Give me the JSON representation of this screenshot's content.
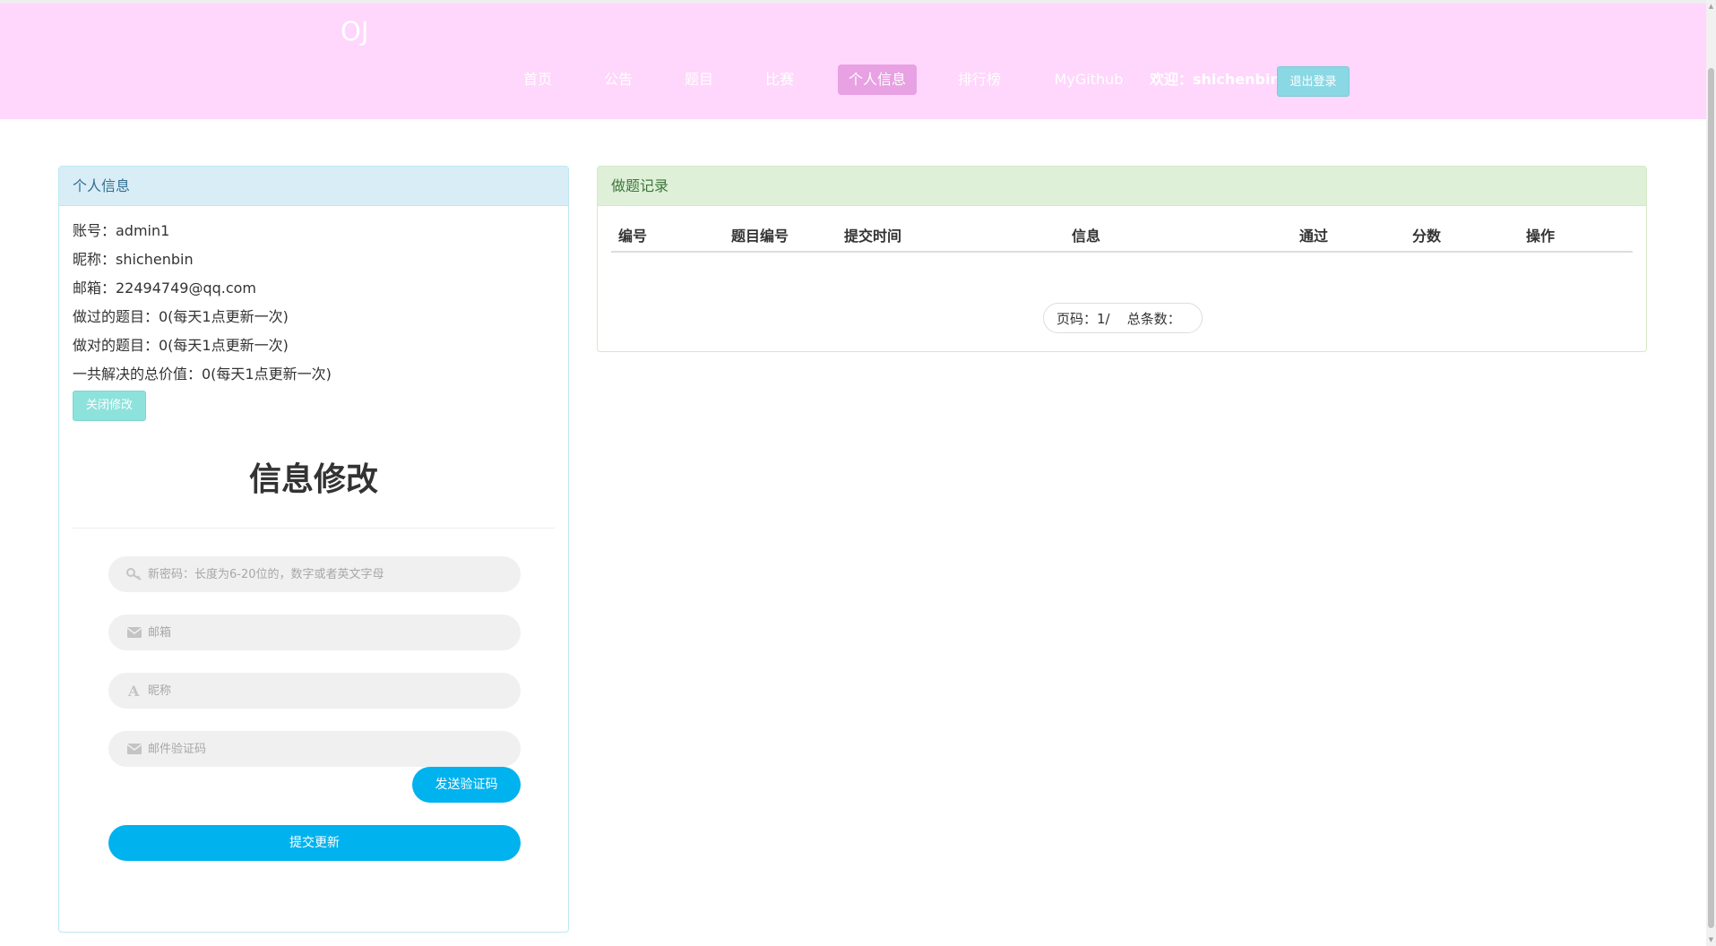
{
  "nav": {
    "brand": "OJ",
    "items": [
      {
        "label": "首页"
      },
      {
        "label": "公告"
      },
      {
        "label": "题目"
      },
      {
        "label": "比赛"
      },
      {
        "label": "个人信息"
      },
      {
        "label": "排行榜"
      },
      {
        "label": "MyGithub"
      }
    ],
    "active_item": "个人信息",
    "welcome": "欢迎：shichenbin",
    "logout_label": "退出登录"
  },
  "profile_panel": {
    "title": "个人信息",
    "account": "账号：admin1",
    "nickname": "昵称：shichenbin",
    "email": "邮箱：22494749@qq.com",
    "attempted": "做过的题目：0(每天1点更新一次)",
    "solved": "做对的题目：0(每天1点更新一次)",
    "total_value": "一共解决的总价值：0(每天1点更新一次)",
    "close_edit_label": "关闭修改"
  },
  "edit_form": {
    "title": "信息修改",
    "password_placeholder": "新密码：长度为6-20位的，数字或者英文字母",
    "email_placeholder": "邮箱",
    "nickname_placeholder": "昵称",
    "code_placeholder": "邮件验证码",
    "send_code_label": "发送验证码",
    "submit_label": "提交更新"
  },
  "records_panel": {
    "title": "做题记录",
    "columns": [
      "编号",
      "题目编号",
      "提交时间",
      "信息",
      "通过",
      "分数",
      "操作"
    ],
    "rows": [],
    "page_label": "页码：1/",
    "total_label": "总条数："
  },
  "icons": {
    "password": "key-icon",
    "email": "envelope-icon",
    "nickname": "font-icon",
    "code": "envelope-icon"
  },
  "colors": {
    "navbar_bg": "#ffd6fc",
    "nav_active_bg": "#e8a1e2",
    "logout_bg": "#8ad8e4",
    "primary_button": "#00b2ee",
    "info_header": "#d9edf7",
    "success_header": "#dff0d8"
  }
}
